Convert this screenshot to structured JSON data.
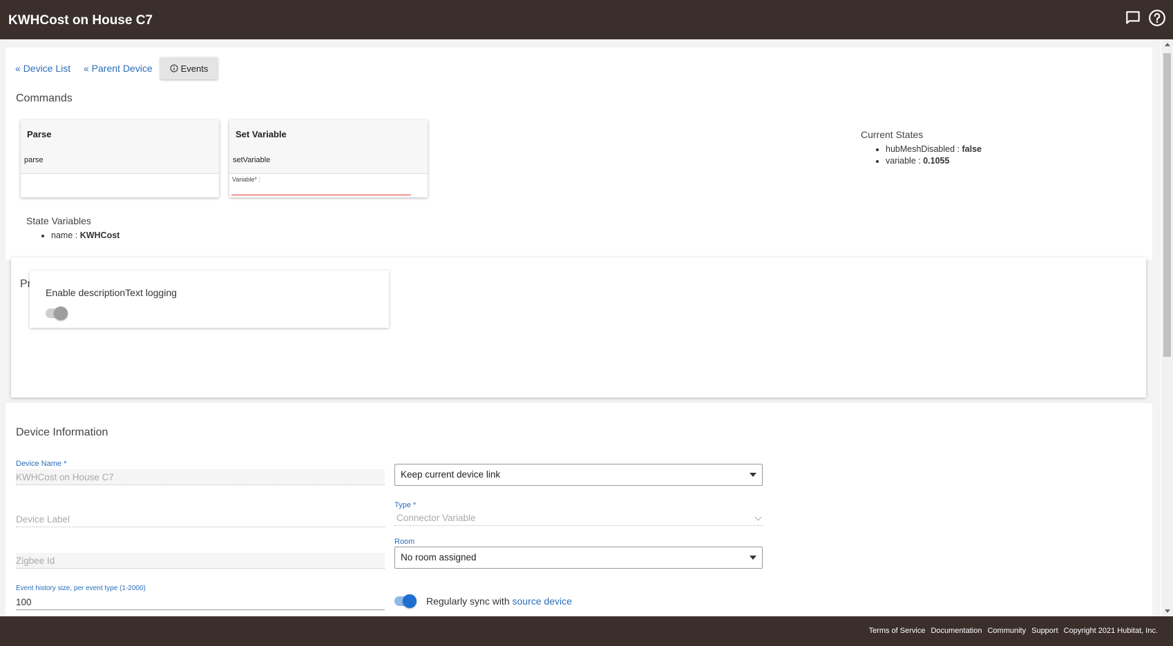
{
  "header": {
    "title": "KWHCost on House C7",
    "feedback_icon": "chat-icon",
    "help_icon": "help-circle-icon"
  },
  "nav": {
    "device_list": "« Device List",
    "parent_device": "« Parent Device",
    "events": "Events",
    "events_icon": "info-icon"
  },
  "commands": {
    "title": "Commands",
    "items": [
      {
        "name": "Parse",
        "method": "parse"
      },
      {
        "name": "Set Variable",
        "method": "setVariable",
        "param_label": "Variable* :"
      }
    ]
  },
  "current_states": {
    "title": "Current States",
    "items": [
      {
        "key": "hubMeshDisabled",
        "sep": " : ",
        "value": "false"
      },
      {
        "key": "variable",
        "sep": " : ",
        "value": "0.1055"
      }
    ]
  },
  "state_variables": {
    "title": "State Variables",
    "items": [
      {
        "key": "name",
        "sep": " : ",
        "value": "KWHCost"
      }
    ]
  },
  "preferences": {
    "title": "Preferences",
    "items": [
      {
        "label": "Enable descriptionText logging",
        "enabled": false
      }
    ]
  },
  "device_info": {
    "title": "Device Information",
    "device_name_label": "Device Name *",
    "device_name_value": "KWHCost on House C7",
    "device_label_placeholder": "Device Label",
    "zigbee_placeholder": "Zigbee Id",
    "event_history_label": "Event history size, per event type (1-2000)",
    "event_history_value": "100",
    "link_select": "Keep current device link",
    "type_label": "Type *",
    "type_value": "Connector Variable",
    "room_label": "Room",
    "room_value": "No room assigned",
    "sync_text": "Regularly sync with ",
    "sync_link": "source device",
    "sync_enabled": true
  },
  "footer": {
    "links": [
      "Terms of Service",
      "Documentation",
      "Community",
      "Support"
    ],
    "copyright": "Copyright 2021 Hubitat, Inc."
  },
  "colors": {
    "header_bg": "#3a2f2b",
    "link": "#2a6eb8",
    "toggle_on": "#1e6fd0",
    "error_line": "#e53935"
  }
}
